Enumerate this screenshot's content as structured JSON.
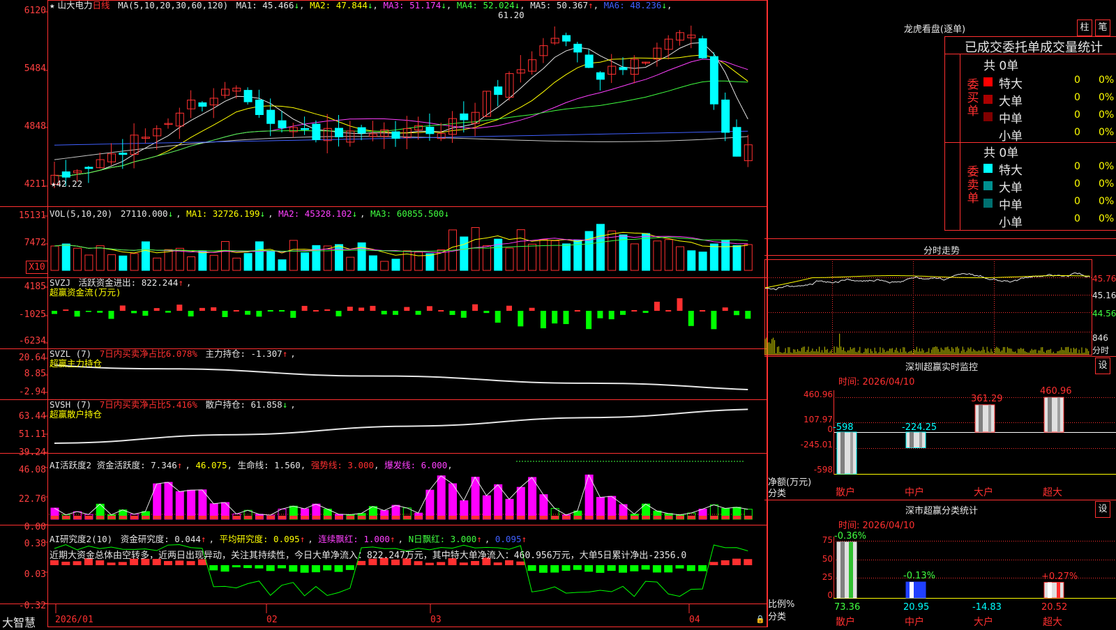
{
  "app": {
    "brand": "大智慧"
  },
  "kline": {
    "stock_name": "山大电力",
    "period": "日线",
    "ma_label": "MA(5,10,20,30,60,120)",
    "ma": [
      {
        "label": "MA1: 45.466",
        "dir": "↓",
        "color": "#e6e6e6"
      },
      {
        "label": "MA2: 47.844",
        "dir": "↓",
        "color": "#ffff00"
      },
      {
        "label": "MA3: 51.174",
        "dir": "↓",
        "color": "#ff40ff"
      },
      {
        "label": "MA4: 52.024",
        "dir": "↓",
        "color": "#40ff40"
      },
      {
        "label": "MA5: 50.367",
        "dir": "↑",
        "color": "#e6e6e6"
      },
      {
        "label": "MA6: 48.236",
        "dir": "↓",
        "color": "#4060ff"
      }
    ],
    "y_ticks": [
      "6120",
      "5484",
      "4848",
      "4211"
    ],
    "high_label": "61.20",
    "low_label": "42.22"
  },
  "vol": {
    "header": "VOL(5,10,20)",
    "value": "27110.000",
    "ma": [
      {
        "label": "MA1: 32726.199",
        "color": "#ffff00"
      },
      {
        "label": "MA2: 45328.102",
        "color": "#ff40ff"
      },
      {
        "label": "MA3: 60855.500",
        "color": "#40ff40"
      }
    ],
    "y_ticks": [
      "15131",
      "7472"
    ],
    "unit": "X10"
  },
  "svzj": {
    "header": "SVZJ",
    "active_label": "活跃资金进出: 822.244",
    "subtitle": "超赢资金流(万元)",
    "y_ticks": [
      "4185",
      "-1025",
      "-6234"
    ]
  },
  "svzl": {
    "header": "SVZL (7)",
    "ratio_label": "7日内买卖净占比6.078%",
    "hold_label": "主力持仓: -1.307",
    "subtitle": "超赢主力持仓",
    "y_ticks": [
      "20.64",
      "8.85",
      "-2.94"
    ]
  },
  "svsh": {
    "header": "SVSH (7)",
    "ratio_label": "7日内买卖净占比5.416%",
    "hold_label": "散户持仓: 61.858",
    "subtitle": "超赢散户持仓",
    "y_ticks": [
      "63.44",
      "51.11",
      "39.24"
    ]
  },
  "ai_active": {
    "header": "AI活跃度2",
    "a": "资金活跃度: 7.346",
    "b": "46.075",
    "c": "生命线: 1.560",
    "d": "强势线: 3.000",
    "e": "爆发线: 6.000",
    "y_ticks": [
      "46.08",
      "22.76",
      "0.00"
    ]
  },
  "ai_research": {
    "header": "AI研究度2(10)",
    "a": "资金研究度: 0.044",
    "b": "平均研究度: 0.095",
    "c": "连续飘红: 1.000",
    "d": "N日飘红: 3.000",
    "e": "0.095",
    "y_ticks": [
      "0.38",
      "0.03",
      "-0.32"
    ],
    "message": "近期大资金总体由空转多，近两日出现异动，关注其持续性，今日大单净流入：822.247万元，其中特大单净流入：460.956万元，大单5日累计净出-2356.0"
  },
  "x_axis": [
    "2026/01",
    "02",
    "03",
    "04"
  ],
  "dragon_tiger": {
    "title": "龙虎看盘(逐单)",
    "btn_zhu": "柱",
    "btn_bi": "笔",
    "subtitle": "已成交委托单成交量统计",
    "buy_side": "委买单",
    "sell_side": "委卖单",
    "buy_total": "共 0单",
    "sell_total": "共 0单",
    "buy_rows": [
      {
        "label": "特大",
        "count": "0",
        "pct": "0%",
        "color": "#ff0000"
      },
      {
        "label": "大单",
        "count": "0",
        "pct": "0%",
        "color": "#aa0000"
      },
      {
        "label": "中单",
        "count": "0",
        "pct": "0%",
        "color": "#800000"
      },
      {
        "label": "小单",
        "count": "0",
        "pct": "0%",
        "color": "#000000"
      }
    ],
    "sell_rows": [
      {
        "label": "特大",
        "count": "0",
        "pct": "0%",
        "color": "#00ffff"
      },
      {
        "label": "大单",
        "count": "0",
        "pct": "0%",
        "color": "#009090"
      },
      {
        "label": "中单",
        "count": "0",
        "pct": "0%",
        "color": "#007070"
      },
      {
        "label": "小单",
        "count": "0",
        "pct": "0%",
        "color": "#000000"
      }
    ]
  },
  "intraday": {
    "title": "分时走势",
    "y_ticks": [
      "45.76",
      "45.16",
      "44.56"
    ],
    "vol_tick": "846",
    "vol_label": "分时"
  },
  "sz_monitor": {
    "title": "深圳超赢实时监控",
    "btn": "设",
    "time": "时间: 2026/04/10",
    "y_ticks": [
      "460.96",
      "107.97",
      "0",
      "-245.01",
      "-598"
    ],
    "y_unit": "净额(万元)",
    "x_unit": "分类",
    "chart_data": {
      "type": "bar",
      "categories": [
        "散户",
        "中户",
        "大户",
        "超大"
      ],
      "values": [
        -598,
        -224.25,
        361.29,
        460.96
      ],
      "ylim": [
        -598,
        460.96
      ]
    }
  },
  "sz_category": {
    "title": "深市超赢分类统计",
    "btn": "设",
    "time": "时间: 2026/04/10",
    "y_ticks": [
      "75",
      "50",
      "25",
      "0"
    ],
    "y_unit": "比例%",
    "x_unit": "分类",
    "chart_data": {
      "type": "bar",
      "categories": [
        "散户",
        "中户",
        "大户",
        "超大"
      ],
      "values": [
        73.36,
        20.95,
        -14.83,
        20.52
      ],
      "changes": [
        "-0.36%",
        "-0.13%",
        "",
        "+0.27%"
      ],
      "ylim": [
        0,
        75
      ]
    }
  }
}
